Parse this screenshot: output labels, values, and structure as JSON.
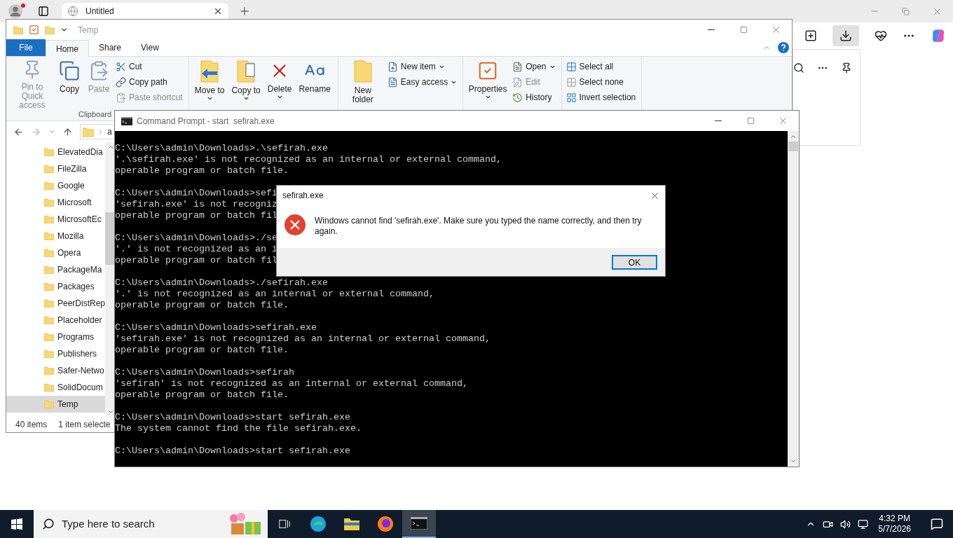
{
  "browser": {
    "tab": {
      "title": "Untitled"
    }
  },
  "explorer": {
    "title": "Temp",
    "tabs": [
      {
        "label": "File",
        "kind": "file",
        "selected": false
      },
      {
        "label": "Home",
        "kind": "tab",
        "selected": true
      },
      {
        "label": "Share",
        "kind": "tab",
        "selected": false
      },
      {
        "label": "View",
        "kind": "tab",
        "selected": false
      }
    ],
    "ribbon": {
      "groups": [
        {
          "label": "Clipboard",
          "items": [
            {
              "label": "Pin to Quick access",
              "kind": "large",
              "disabled": true,
              "dropdown": false
            },
            {
              "label": "Copy",
              "kind": "large",
              "disabled": false,
              "dropdown": false
            },
            {
              "label": "Paste",
              "kind": "large",
              "disabled": true,
              "dropdown": false
            },
            {
              "label": "Cut",
              "kind": "small",
              "disabled": false,
              "dropdown": false
            },
            {
              "label": "Copy path",
              "kind": "small",
              "disabled": false,
              "dropdown": false
            },
            {
              "label": "Paste shortcut",
              "kind": "small",
              "disabled": true,
              "dropdown": false
            }
          ]
        },
        {
          "items": [
            {
              "label": "Move to",
              "kind": "large",
              "disabled": false,
              "dropdown": true
            },
            {
              "label": "Copy to",
              "kind": "large",
              "disabled": false,
              "dropdown": true
            },
            {
              "label": "Delete",
              "kind": "large",
              "disabled": false,
              "dropdown": true
            },
            {
              "label": "Rename",
              "kind": "large",
              "disabled": false,
              "dropdown": false
            }
          ]
        },
        {
          "items": [
            {
              "label": "New folder",
              "kind": "large",
              "disabled": false,
              "dropdown": false
            },
            {
              "label": "New item",
              "kind": "small",
              "disabled": false,
              "dropdown": true
            },
            {
              "label": "Easy access",
              "kind": "small",
              "disabled": false,
              "dropdown": true
            }
          ]
        },
        {
          "items": [
            {
              "label": "Properties",
              "kind": "large",
              "disabled": false,
              "dropdown": true
            },
            {
              "label": "Open",
              "kind": "small",
              "disabled": false,
              "dropdown": true
            },
            {
              "label": "Edit",
              "kind": "small",
              "disabled": true,
              "dropdown": false
            },
            {
              "label": "History",
              "kind": "small",
              "disabled": false,
              "dropdown": false
            }
          ]
        },
        {
          "items": [
            {
              "label": "Select all",
              "kind": "small",
              "disabled": false,
              "dropdown": false
            },
            {
              "label": "Select none",
              "kind": "small",
              "disabled": false,
              "dropdown": false
            },
            {
              "label": "Invert selection",
              "kind": "small",
              "disabled": false,
              "dropdown": false
            }
          ]
        }
      ]
    },
    "address": {
      "crumb": "a"
    },
    "nav_pane": {
      "items": [
        {
          "label": "ElevatedDia",
          "selected": false
        },
        {
          "label": "FileZilla",
          "selected": false
        },
        {
          "label": "Google",
          "selected": false
        },
        {
          "label": "Microsoft",
          "selected": false
        },
        {
          "label": "MicrosoftEc",
          "selected": false
        },
        {
          "label": "Mozilla",
          "selected": false
        },
        {
          "label": "Opera",
          "selected": false
        },
        {
          "label": "PackageMa",
          "selected": false
        },
        {
          "label": "Packages",
          "selected": false
        },
        {
          "label": "PeerDistRep",
          "selected": false
        },
        {
          "label": "Placeholder",
          "selected": false
        },
        {
          "label": "Programs",
          "selected": false
        },
        {
          "label": "Publishers",
          "selected": false
        },
        {
          "label": "Safer-Netwo",
          "selected": false
        },
        {
          "label": "SolidDocum",
          "selected": false
        },
        {
          "label": "Temp",
          "selected": true
        }
      ]
    },
    "status_bar": {
      "item_count": "40 items",
      "selection": "1 item selecte"
    }
  },
  "command_prompt": {
    "title": "Command Prompt - start  sefirah.exe",
    "blocks": [
      [
        "C:\\Users\\admin\\Downloads>.\\sefirah.exe",
        "'.\\sefirah.exe' is not recognized as an internal or external command,",
        "operable program or batch file."
      ],
      [
        "C:\\Users\\admin\\Downloads>sefi",
        "'sefirah.exe' is not recogniz",
        "operable program or batch fil"
      ],
      [
        "C:\\Users\\admin\\Downloads>./se",
        "'.' is not recognized as an i",
        "operable program or batch fil"
      ],
      [
        "C:\\Users\\admin\\Downloads>./sefirah.exe",
        "'.' is not recognized as an internal or external command,",
        "operable program or batch file."
      ],
      [
        "C:\\Users\\admin\\Downloads>sefirah.exe",
        "'sefirah.exe' is not recognized as an internal or external command,",
        "operable program or batch file."
      ],
      [
        "C:\\Users\\admin\\Downloads>sefirah",
        "'sefirah' is not recognized as an internal or external command,",
        "operable program or batch file."
      ],
      [
        "C:\\Users\\admin\\Downloads>start sefirah.exe",
        "The system cannot find the file sefirah.exe."
      ],
      [
        "C:\\Users\\admin\\Downloads>start sefirah.exe"
      ]
    ]
  },
  "dialog": {
    "title": "sefirah.exe",
    "message": "Windows cannot find 'sefirah.exe'. Make sure you typed the name correctly, and then try again.",
    "buttons": [
      "OK"
    ]
  },
  "taskbar": {
    "search": {
      "placeholder": "Type here to search"
    },
    "apps": [
      {
        "selected": false
      },
      {
        "selected": false
      },
      {
        "selected": false
      },
      {
        "selected": false
      },
      {
        "selected": true
      }
    ],
    "time": "4:32 PM",
    "date": "5/7/2026"
  }
}
